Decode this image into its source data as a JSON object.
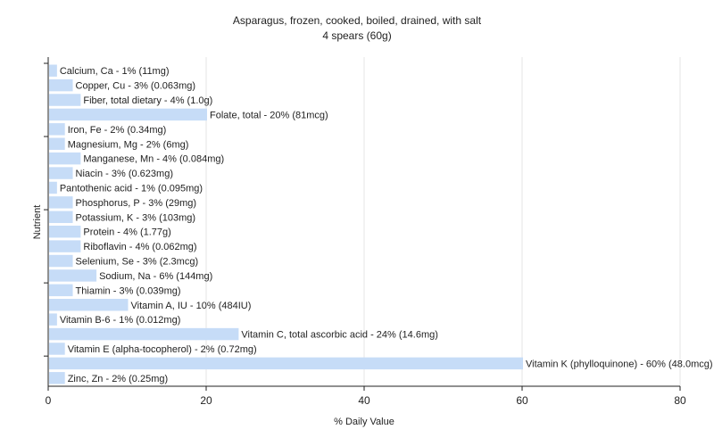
{
  "chart_data": {
    "type": "bar",
    "orientation": "horizontal",
    "title": "Asparagus, frozen, cooked, boiled, drained, with salt",
    "subtitle": "4 spears (60g)",
    "xlabel": "% Daily Value",
    "ylabel": "Nutrient",
    "xlim": [
      0,
      80
    ],
    "xticks": [
      0,
      20,
      40,
      60,
      80
    ],
    "grid": true,
    "bar_color": "#c6dcf7",
    "categories": [
      "Calcium, Ca - 1% (11mg)",
      "Copper, Cu - 3% (0.063mg)",
      "Fiber, total dietary - 4% (1.0g)",
      "Folate, total - 20% (81mcg)",
      "Iron, Fe - 2% (0.34mg)",
      "Magnesium, Mg - 2% (6mg)",
      "Manganese, Mn - 4% (0.084mg)",
      "Niacin - 3% (0.623mg)",
      "Pantothenic acid - 1% (0.095mg)",
      "Phosphorus, P - 3% (29mg)",
      "Potassium, K - 3% (103mg)",
      "Protein - 4% (1.77g)",
      "Riboflavin - 4% (0.062mg)",
      "Selenium, Se - 3% (2.3mcg)",
      "Sodium, Na - 6% (144mg)",
      "Thiamin - 3% (0.039mg)",
      "Vitamin A, IU - 10% (484IU)",
      "Vitamin B-6 - 1% (0.012mg)",
      "Vitamin C, total ascorbic acid - 24% (14.6mg)",
      "Vitamin E (alpha-tocopherol) - 2% (0.72mg)",
      "Vitamin K (phylloquinone) - 60% (48.0mcg)",
      "Zinc, Zn - 2% (0.25mg)"
    ],
    "values": [
      1,
      3,
      4,
      20,
      2,
      2,
      4,
      3,
      1,
      3,
      3,
      4,
      4,
      3,
      6,
      3,
      10,
      1,
      24,
      2,
      60,
      2
    ]
  }
}
